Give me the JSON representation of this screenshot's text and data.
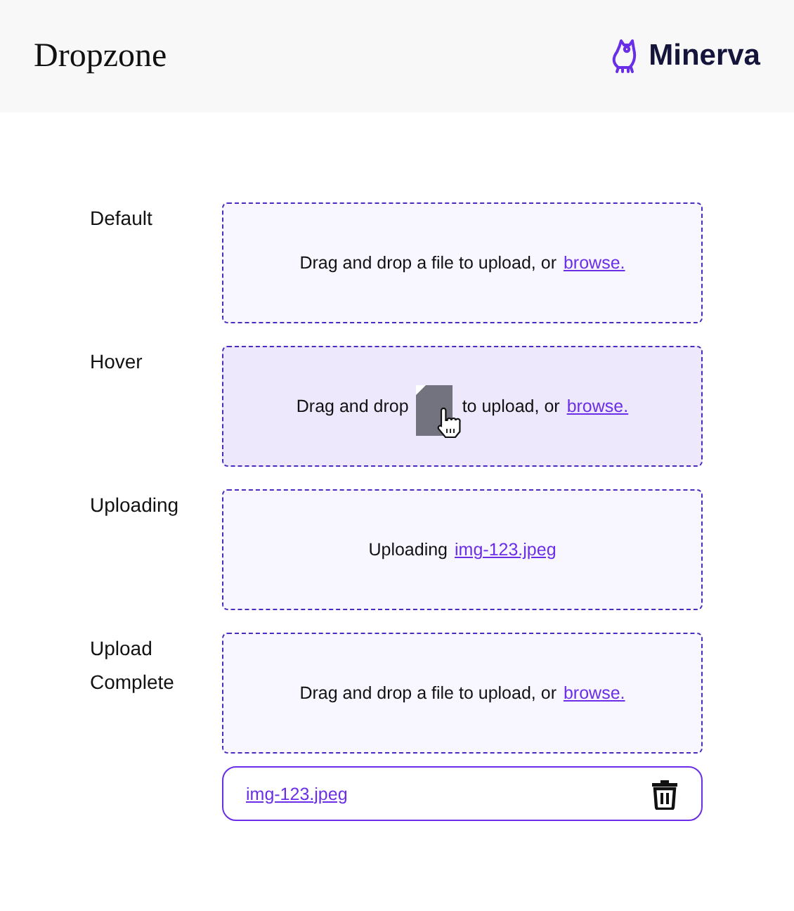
{
  "header": {
    "title": "Dropzone",
    "brand": "Minerva"
  },
  "states": [
    {
      "label": "Default",
      "kind": "default",
      "text": "Drag and drop a file to upload, or",
      "link": "browse."
    },
    {
      "label": "Hover",
      "kind": "hover",
      "text": "Drag and drop",
      "text_after": "to upload, or",
      "link": "browse."
    },
    {
      "label": "Uploading",
      "kind": "uploading",
      "text": "Uploading",
      "link": "img-123.jpeg"
    },
    {
      "label": "Upload Complete",
      "kind": "complete",
      "text": "Drag and drop a file to upload, or",
      "link": "browse.",
      "file": {
        "name": "img-123.jpeg"
      }
    }
  ]
}
